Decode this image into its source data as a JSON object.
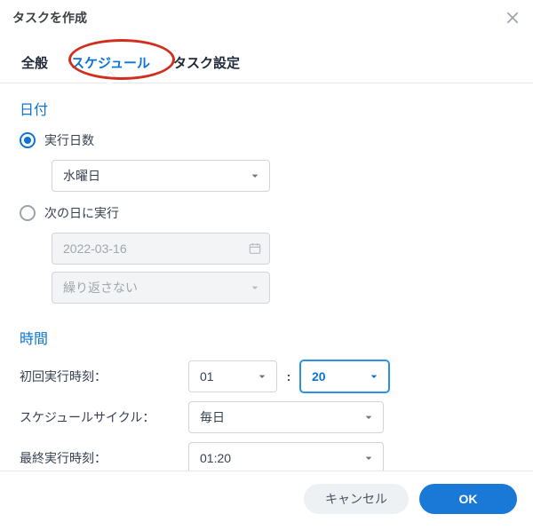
{
  "dialog": {
    "title": "タスクを作成"
  },
  "tabs": {
    "items": [
      {
        "label": "全般"
      },
      {
        "label": "スケジュール"
      },
      {
        "label": "タスク設定"
      }
    ],
    "active_index": 1
  },
  "date_section": {
    "title": "日付",
    "radio_run_days": {
      "label": "実行日数",
      "checked": true,
      "value": "水曜日"
    },
    "radio_next_run": {
      "label": "次の日に実行",
      "checked": false,
      "date_value": "2022-03-16",
      "repeat_value": "繰り返さない"
    }
  },
  "time_section": {
    "title": "時間",
    "first_run": {
      "label": "初回実行時刻：",
      "hour": "01",
      "minute": "20"
    },
    "cycle": {
      "label": "スケジュールサイクル：",
      "value": "毎日"
    },
    "last_run": {
      "label": "最終実行時刻：",
      "value": "01:20"
    }
  },
  "footer": {
    "cancel": "キャンセル",
    "ok": "OK"
  }
}
